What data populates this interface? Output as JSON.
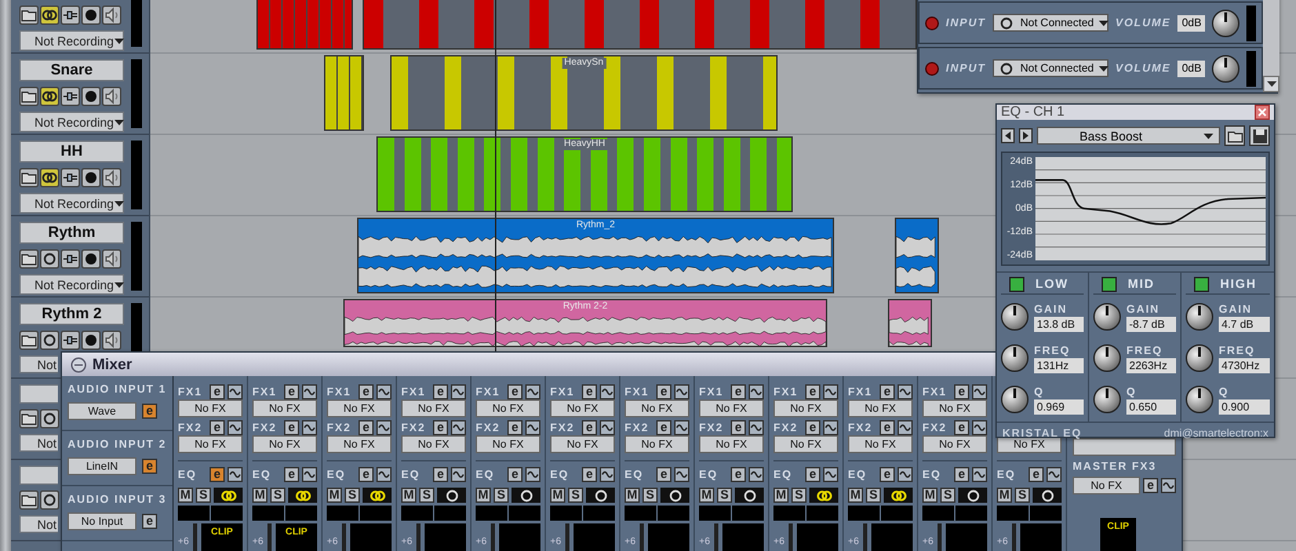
{
  "tracks": [
    {
      "kind": "drum",
      "linked": true,
      "record_mode": "Not Recording",
      "color": "#cc0000"
    },
    {
      "kind": "drum",
      "name": "Snare",
      "linked": true,
      "record_mode": "Not Recording",
      "color": "#c8c800",
      "clip_name": "HeavySn"
    },
    {
      "kind": "drum",
      "name": "HH",
      "linked": true,
      "record_mode": "Not Recording",
      "color": "#5cc400",
      "clip_name": "HeavyHH"
    },
    {
      "kind": "audio",
      "name": "Rythm",
      "linked": false,
      "record_mode": "Not Recording",
      "color": "#0a6cc8",
      "clip_name": "Rythm_2"
    },
    {
      "kind": "audio",
      "name": "Rythm 2",
      "linked": false,
      "record_mode": "Not",
      "color": "#d066a0",
      "clip_name": "Rythm 2-2"
    },
    {
      "linked": false,
      "record_mode": "Not"
    },
    {
      "linked": false,
      "record_mode": "Not"
    }
  ],
  "inputs_window": {
    "rows": [
      {
        "label": "INPUT",
        "source": "Not Connected",
        "volume_label": "VOLUME",
        "volume": "0dB"
      },
      {
        "label": "INPUT",
        "source": "Not Connected",
        "volume_label": "VOLUME",
        "volume": "0dB"
      }
    ]
  },
  "mixer": {
    "title": "Mixer",
    "inputs": [
      {
        "label": "AUDIO INPUT 1",
        "source": "Wave",
        "edit": "e",
        "edit_active": true
      },
      {
        "label": "AUDIO INPUT 2",
        "source": "LineIN",
        "edit": "e",
        "edit_active": true
      },
      {
        "label": "AUDIO INPUT 3",
        "source": "No Input",
        "edit": "e",
        "edit_active": false
      }
    ],
    "strips": [
      {
        "slots": [
          {
            "label": "FX1",
            "value": "No FX",
            "edit": "e"
          },
          {
            "label": "FX2",
            "value": "No FX",
            "edit": "e"
          }
        ],
        "eq": {
          "label": "EQ",
          "edit": "e",
          "active": true
        },
        "mute": "M",
        "solo": "S",
        "linked": true,
        "clip": "CLIP",
        "scale": "+6"
      },
      {
        "slots": [
          {
            "label": "FX1",
            "value": "No FX",
            "edit": "e"
          },
          {
            "label": "FX2",
            "value": "No FX",
            "edit": "e"
          }
        ],
        "eq": {
          "label": "EQ",
          "edit": "e",
          "active": false
        },
        "mute": "M",
        "solo": "S",
        "linked": true,
        "clip": "CLIP",
        "scale": "+6"
      },
      {
        "slots": [
          {
            "label": "FX1",
            "value": "No FX",
            "edit": "e"
          },
          {
            "label": "FX2",
            "value": "No FX",
            "edit": "e"
          }
        ],
        "eq": {
          "label": "EQ",
          "edit": "e",
          "active": false
        },
        "mute": "M",
        "solo": "S",
        "linked": true,
        "scale": "+6"
      },
      {
        "slots": [
          {
            "label": "FX1",
            "value": "No FX",
            "edit": "e"
          },
          {
            "label": "FX2",
            "value": "No FX",
            "edit": "e"
          }
        ],
        "eq": {
          "label": "EQ",
          "edit": "e",
          "active": false
        },
        "mute": "M",
        "solo": "S",
        "linked": false,
        "scale": "+6"
      },
      {
        "slots": [
          {
            "label": "FX1",
            "value": "No FX",
            "edit": "e"
          },
          {
            "label": "FX2",
            "value": "No FX",
            "edit": "e"
          }
        ],
        "eq": {
          "label": "EQ",
          "edit": "e",
          "active": false
        },
        "mute": "M",
        "solo": "S",
        "linked": false,
        "scale": "+6"
      },
      {
        "slots": [
          {
            "label": "FX1",
            "value": "No FX",
            "edit": "e"
          },
          {
            "label": "FX2",
            "value": "No FX",
            "edit": "e"
          }
        ],
        "eq": {
          "label": "EQ",
          "edit": "e",
          "active": false
        },
        "mute": "M",
        "solo": "S",
        "linked": false,
        "scale": "+6"
      },
      {
        "slots": [
          {
            "label": "FX1",
            "value": "No FX",
            "edit": "e"
          },
          {
            "label": "FX2",
            "value": "No FX",
            "edit": "e"
          }
        ],
        "eq": {
          "label": "EQ",
          "edit": "e",
          "active": false
        },
        "mute": "M",
        "solo": "S",
        "linked": false,
        "scale": "+6"
      },
      {
        "slots": [
          {
            "label": "FX1",
            "value": "No FX",
            "edit": "e"
          },
          {
            "label": "FX2",
            "value": "No FX",
            "edit": "e"
          }
        ],
        "eq": {
          "label": "EQ",
          "edit": "e",
          "active": false
        },
        "mute": "M",
        "solo": "S",
        "linked": false,
        "scale": "+6"
      },
      {
        "slots": [
          {
            "label": "FX1",
            "value": "No FX",
            "edit": "e"
          },
          {
            "label": "FX2",
            "value": "No FX",
            "edit": "e"
          }
        ],
        "eq": {
          "label": "EQ",
          "edit": "e",
          "active": false
        },
        "mute": "M",
        "solo": "S",
        "linked": true,
        "scale": "+6"
      },
      {
        "slots": [
          {
            "label": "FX1",
            "value": "No FX",
            "edit": "e"
          },
          {
            "label": "FX2",
            "value": "No FX",
            "edit": "e"
          }
        ],
        "eq": {
          "label": "EQ",
          "edit": "e",
          "active": false
        },
        "mute": "M",
        "solo": "S",
        "linked": true,
        "scale": "+6"
      },
      {
        "slots": [
          {
            "label": "FX1",
            "value": "No FX",
            "edit": "e"
          },
          {
            "label": "FX2",
            "value": "No FX",
            "edit": "e"
          }
        ],
        "eq": {
          "label": "EQ",
          "edit": "e",
          "active": false
        },
        "mute": "M",
        "solo": "S",
        "linked": false,
        "scale": "+6"
      },
      {
        "slots": [
          {
            "value": "No FX"
          }
        ],
        "eq": {
          "label": "EQ",
          "edit": "e",
          "active": false
        },
        "mute": "M",
        "solo": "S",
        "linked": false,
        "scale": "+6"
      }
    ],
    "master": {
      "label": "MASTER FX3",
      "value": "No FX",
      "edit": "e",
      "clip": "CLIP"
    }
  },
  "eq_window": {
    "title": "EQ - CH 1",
    "preset": "Bass Boost",
    "graph_labels": [
      "24dB",
      "12dB",
      "0dB",
      "-12dB",
      "-24dB"
    ],
    "bands": [
      {
        "name": "LOW",
        "on": true,
        "knobs": [
          {
            "label": "GAIN",
            "value": "13.8 dB"
          },
          {
            "label": "FREQ",
            "value": "131Hz"
          },
          {
            "label": "Q",
            "value": "0.969"
          }
        ]
      },
      {
        "name": "MID",
        "on": true,
        "knobs": [
          {
            "label": "GAIN",
            "value": "-8.7 dB"
          },
          {
            "label": "FREQ",
            "value": "2263Hz"
          },
          {
            "label": "Q",
            "value": "0.650"
          }
        ]
      },
      {
        "name": "HIGH",
        "on": true,
        "knobs": [
          {
            "label": "GAIN",
            "value": "4.7 dB"
          },
          {
            "label": "FREQ",
            "value": "4730Hz"
          },
          {
            "label": "Q",
            "value": "0.900"
          }
        ]
      }
    ],
    "footer_left": "KRISTAL EQ",
    "footer_right": "dmi@smartelectron:x"
  }
}
